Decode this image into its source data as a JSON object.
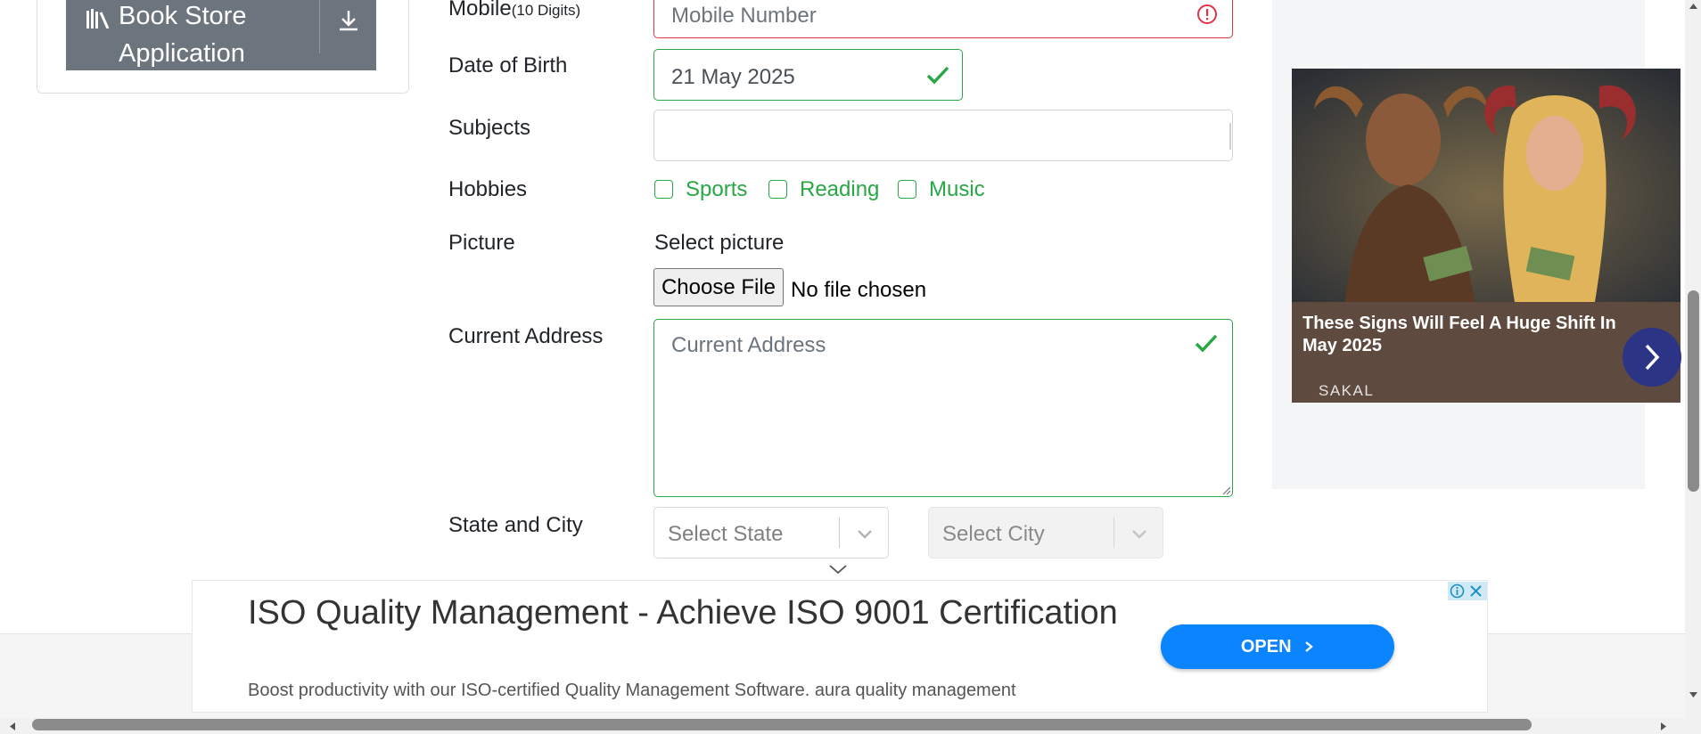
{
  "sidebar": {
    "book_store_line1": "Book Store",
    "book_store_line2": "Application"
  },
  "form": {
    "mobile_label": "Mobile",
    "mobile_hint": "(10 Digits)",
    "mobile_placeholder": "Mobile Number",
    "dob_label": "Date of Birth",
    "dob_value": "21 May 2025",
    "subjects_label": "Subjects",
    "hobbies_label": "Hobbies",
    "hobbies": [
      "Sports",
      "Reading",
      "Music"
    ],
    "picture_label": "Picture",
    "select_picture": "Select picture",
    "choose_file": "Choose File",
    "no_file": "No file chosen",
    "address_label": "Current Address",
    "address_placeholder": "Current Address",
    "state_city_label": "State and City",
    "state_placeholder": "Select State",
    "city_placeholder": "Select City"
  },
  "side_ad": {
    "headline": "These Signs Will Feel A Huge Shift In May 2025",
    "source": "SAKAL"
  },
  "banner_ad": {
    "title": "ISO Quality Management - Achieve ISO 9001 Certification",
    "description": "Boost productivity with our ISO-certified Quality Management Software. aura quality management",
    "open_label": "OPEN"
  },
  "colors": {
    "valid": "#28a745",
    "invalid": "#dc3545",
    "button_gray": "#6c757d",
    "open_blue": "#0a84ff"
  }
}
